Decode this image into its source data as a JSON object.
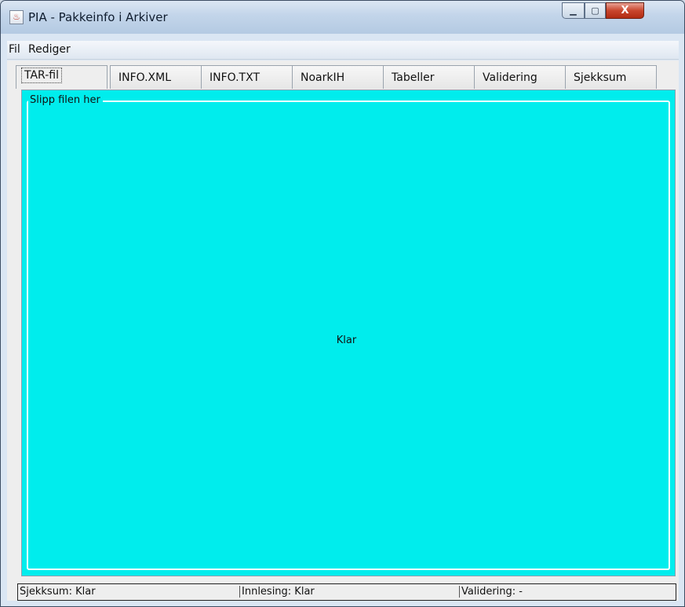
{
  "window": {
    "title": "PIA - Pakkeinfo i Arkiver",
    "icon": "java-cup-icon",
    "minimize_glyph": "▁",
    "maximize_glyph": "▢",
    "close_glyph": "X"
  },
  "menubar": {
    "items": [
      {
        "label": "Fil"
      },
      {
        "label": "Rediger"
      }
    ]
  },
  "tabs": [
    {
      "label": "TAR-fil",
      "active": true
    },
    {
      "label": "INFO.XML",
      "active": false
    },
    {
      "label": "INFO.TXT",
      "active": false
    },
    {
      "label": "NoarkIH",
      "active": false
    },
    {
      "label": "Tabeller",
      "active": false
    },
    {
      "label": "Validering",
      "active": false
    },
    {
      "label": "Sjekksum",
      "active": false
    }
  ],
  "dropzone": {
    "legend": "Slipp filen her",
    "status": "Klar",
    "background_color": "#00eded"
  },
  "statusbar": {
    "checksum": "Sjekksum: Klar",
    "loading": "Innlesing: Klar",
    "validation": "Validering: -"
  }
}
